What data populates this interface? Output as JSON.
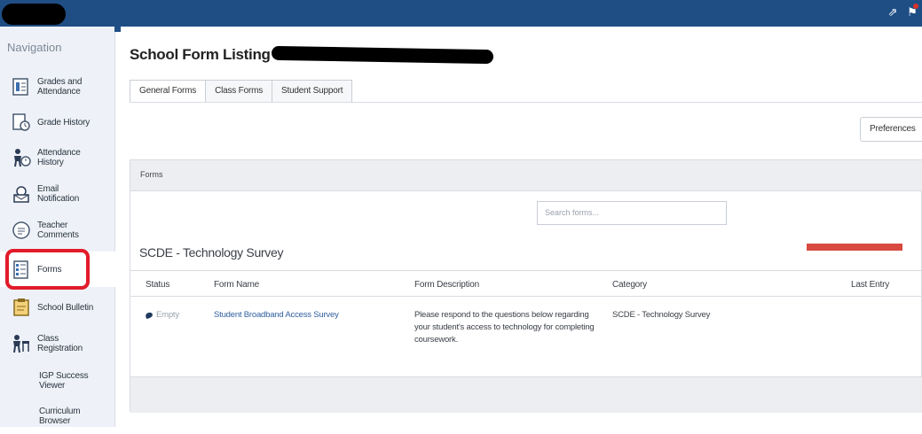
{
  "navigation": {
    "title": "Navigation",
    "items": [
      {
        "label": "Grades and\nAttendance",
        "icon": "grades-icon"
      },
      {
        "label": "Grade History",
        "icon": "grade-history-icon"
      },
      {
        "label": "Attendance\nHistory",
        "icon": "attendance-icon"
      },
      {
        "label": "Email\nNotification",
        "icon": "email-icon"
      },
      {
        "label": "Teacher\nComments",
        "icon": "comments-icon"
      },
      {
        "label": "Forms",
        "icon": "forms-icon"
      },
      {
        "label": "School Bulletin",
        "icon": "bulletin-icon"
      },
      {
        "label": "Class\nRegistration",
        "icon": "registration-icon"
      },
      {
        "label": "IGP Success\nViewer",
        "icon": ""
      },
      {
        "label": "Curriculum\nBrowser",
        "icon": ""
      }
    ]
  },
  "page": {
    "title": "School Form Listing for",
    "tabs": [
      "General Forms",
      "Class Forms",
      "Student Support"
    ],
    "preferences_label": "Preferences"
  },
  "panel": {
    "header": "Forms",
    "search_placeholder": "Search forms...",
    "section_title": "SCDE - Technology Survey",
    "columns": [
      "Status",
      "Form Name",
      "Form Description",
      "Category",
      "Last Entry"
    ],
    "rows": [
      {
        "status": "Empty",
        "form_name": "Student Broadband Access Survey",
        "description": "Please respond to the questions below regarding your student's access to technology for completing coursework.",
        "category": "SCDE - Technology Survey",
        "last_entry": ""
      }
    ]
  },
  "colors": {
    "topbar": "#1f4e85",
    "highlight": "#e11b2a",
    "link": "#2f5f9e"
  }
}
